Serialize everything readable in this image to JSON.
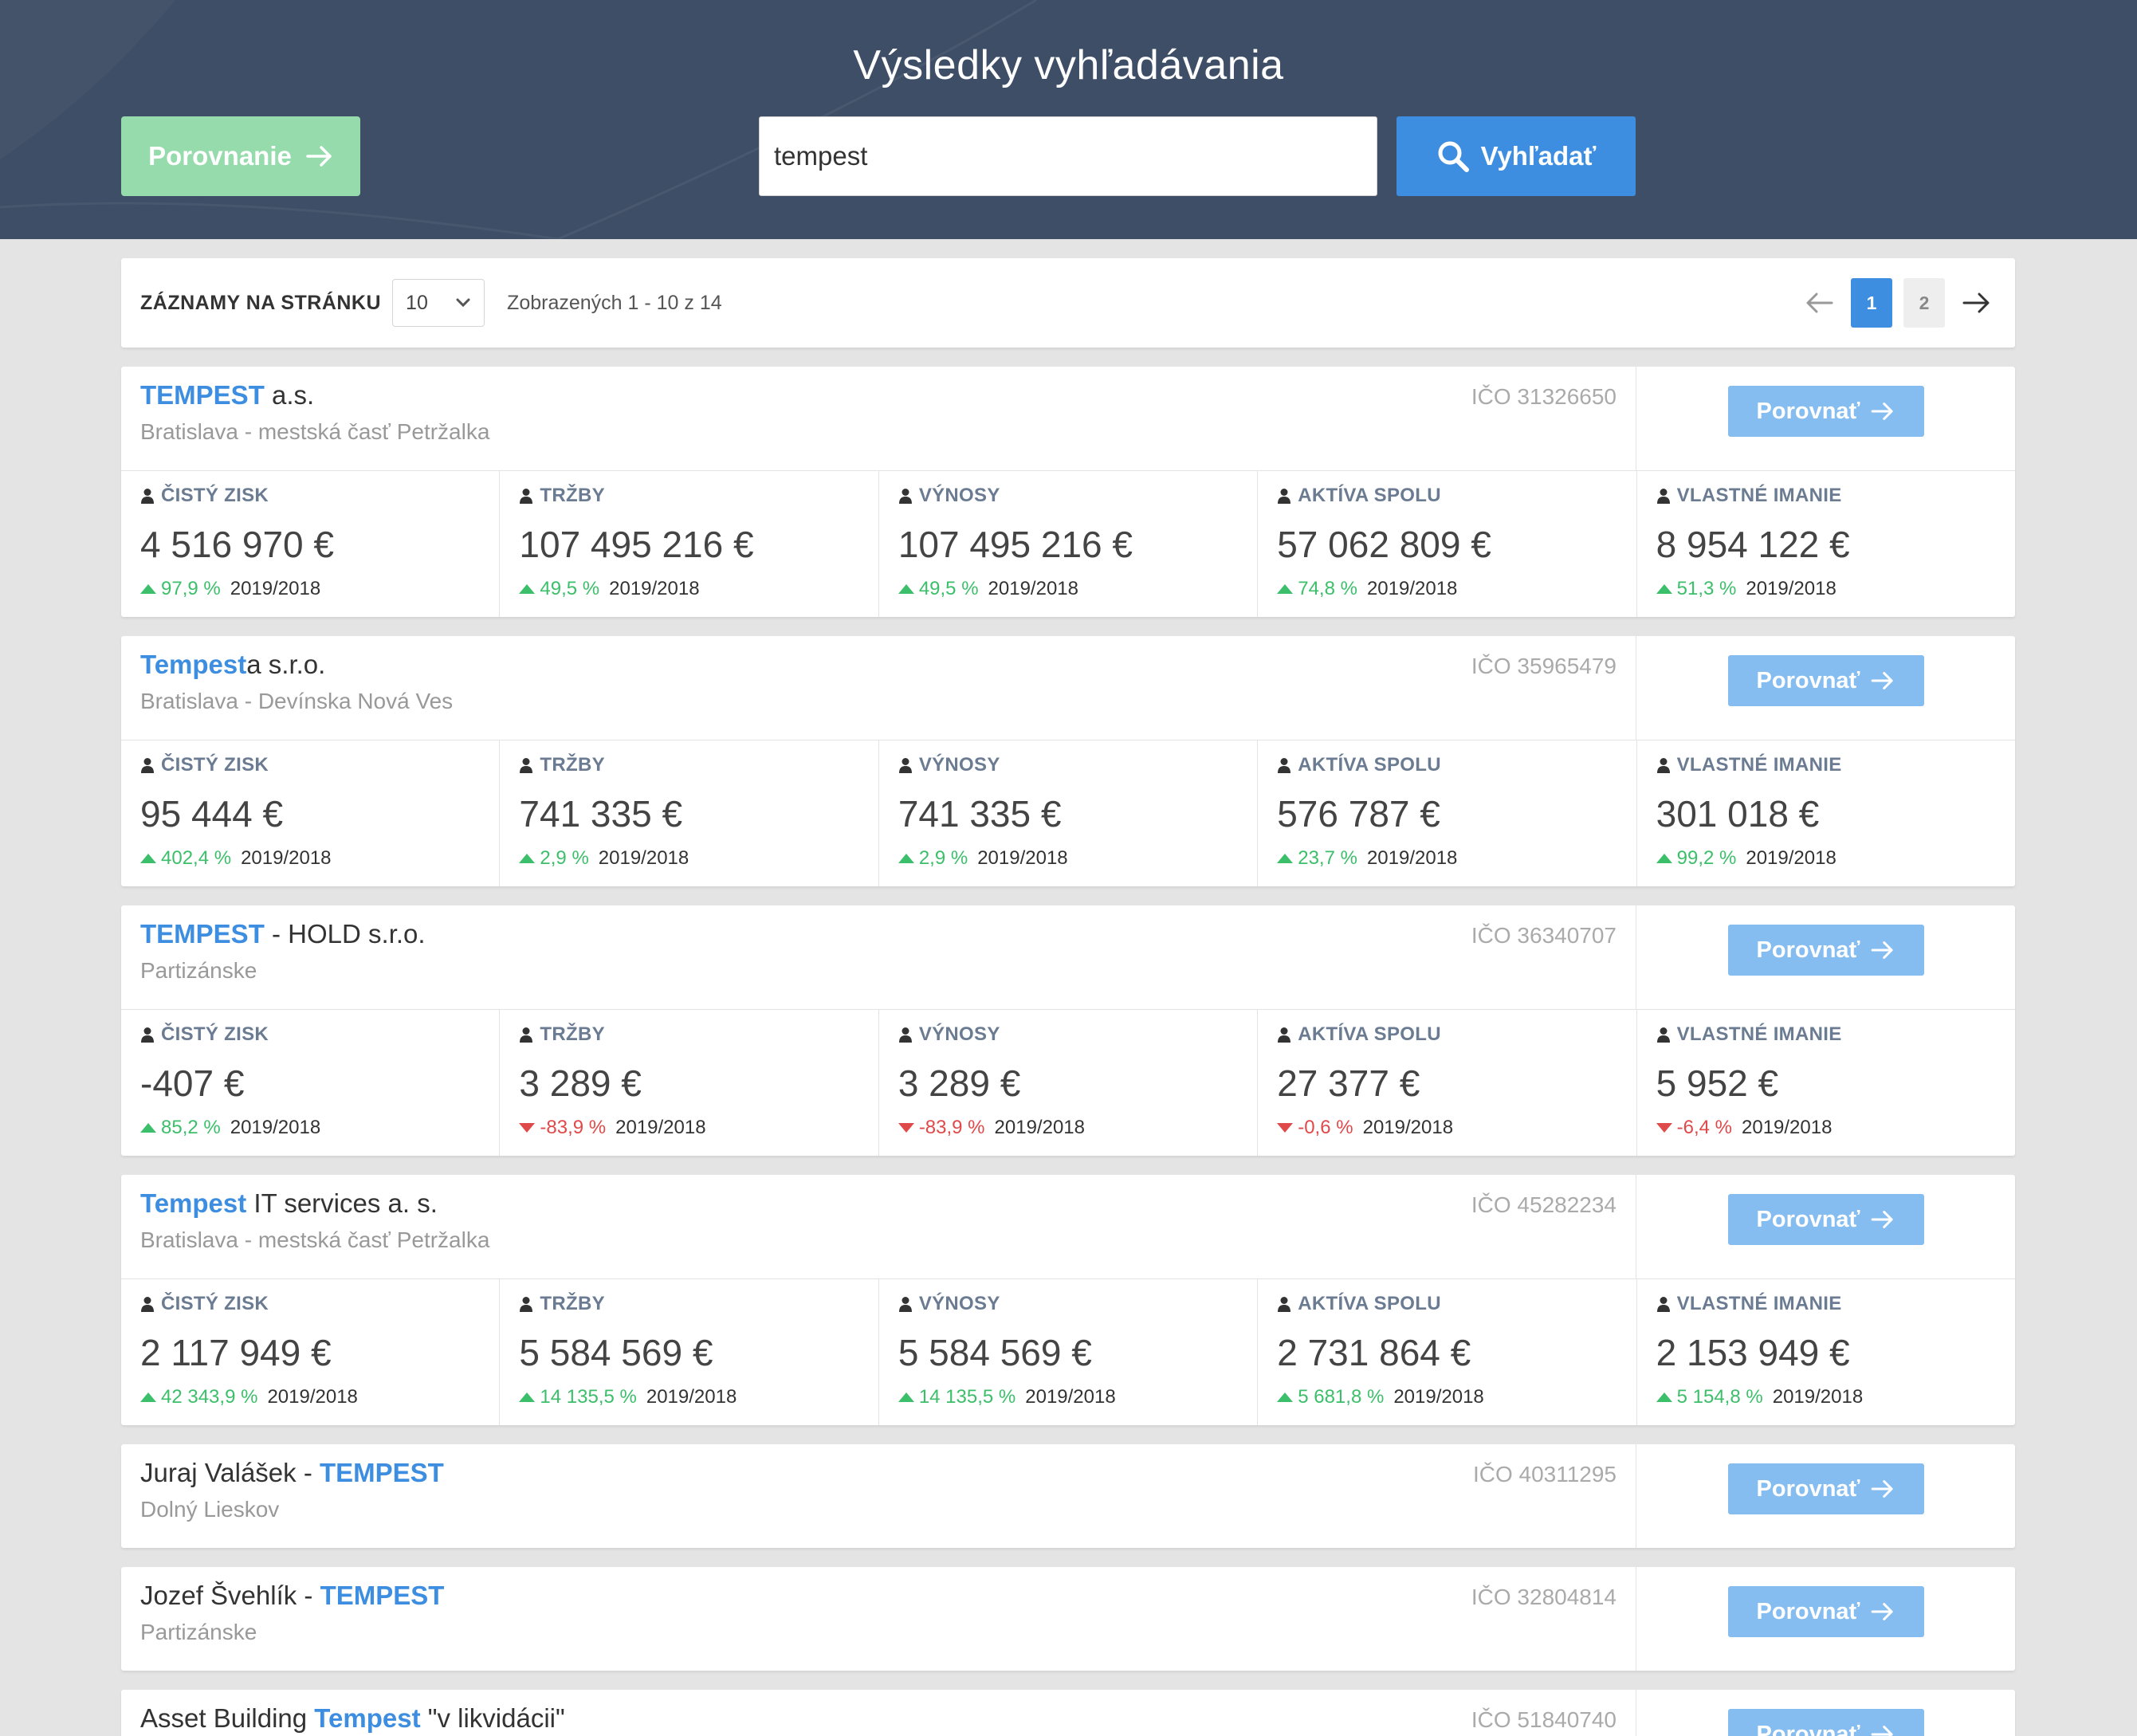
{
  "header": {
    "title": "Výsledky vyhľadávania",
    "compare_label": "Porovnanie",
    "search_value": "tempest",
    "search_label": "Vyhľadať"
  },
  "toolbar": {
    "per_page_label": "ZÁZNAMY NA STRÁNKU",
    "per_page_value": "10",
    "showing_text": "Zobrazených 1 - 10 z 14",
    "pages": [
      "1",
      "2"
    ],
    "current_page": "1"
  },
  "metric_labels": [
    "ČISTÝ ZISK",
    "TRŽBY",
    "VÝNOSY",
    "AKTÍVA SPOLU",
    "VLASTNÉ IMANIE"
  ],
  "compare_button_label": "Porovnať",
  "colors": {
    "header_bg": "#3e4e66",
    "primary": "#3d8ee0",
    "compare_green": "#96dbac",
    "up": "#3cbf6a",
    "down": "#e0494a"
  },
  "companies": [
    {
      "name_parts": [
        {
          "text": "TEMPEST",
          "hl": true
        },
        {
          "text": " a.s.",
          "hl": false
        }
      ],
      "city": "Bratislava - mestská časť Petržalka",
      "ico": "IČO 31326650",
      "metrics": [
        {
          "value": "4 516 970 €",
          "change": "97,9 %",
          "dir": "up",
          "period": "2019/2018"
        },
        {
          "value": "107 495 216 €",
          "change": "49,5 %",
          "dir": "up",
          "period": "2019/2018"
        },
        {
          "value": "107 495 216 €",
          "change": "49,5 %",
          "dir": "up",
          "period": "2019/2018"
        },
        {
          "value": "57 062 809 €",
          "change": "74,8 %",
          "dir": "up",
          "period": "2019/2018"
        },
        {
          "value": "8 954 122 €",
          "change": "51,3 %",
          "dir": "up",
          "period": "2019/2018"
        }
      ]
    },
    {
      "name_parts": [
        {
          "text": "Tempest",
          "hl": true
        },
        {
          "text": "a s.r.o.",
          "hl": false
        }
      ],
      "city": "Bratislava - Devínska Nová Ves",
      "ico": "IČO 35965479",
      "metrics": [
        {
          "value": "95 444 €",
          "change": "402,4 %",
          "dir": "up",
          "period": "2019/2018"
        },
        {
          "value": "741 335 €",
          "change": "2,9 %",
          "dir": "up",
          "period": "2019/2018"
        },
        {
          "value": "741 335 €",
          "change": "2,9 %",
          "dir": "up",
          "period": "2019/2018"
        },
        {
          "value": "576 787 €",
          "change": "23,7 %",
          "dir": "up",
          "period": "2019/2018"
        },
        {
          "value": "301 018 €",
          "change": "99,2 %",
          "dir": "up",
          "period": "2019/2018"
        }
      ]
    },
    {
      "name_parts": [
        {
          "text": "TEMPEST",
          "hl": true
        },
        {
          "text": " - HOLD s.r.o.",
          "hl": false
        }
      ],
      "city": "Partizánske",
      "ico": "IČO 36340707",
      "metrics": [
        {
          "value": "-407 €",
          "change": "85,2 %",
          "dir": "up",
          "period": "2019/2018"
        },
        {
          "value": "3 289 €",
          "change": "-83,9 %",
          "dir": "down",
          "period": "2019/2018"
        },
        {
          "value": "3 289 €",
          "change": "-83,9 %",
          "dir": "down",
          "period": "2019/2018"
        },
        {
          "value": "27 377 €",
          "change": "-0,6 %",
          "dir": "down",
          "period": "2019/2018"
        },
        {
          "value": "5 952 €",
          "change": "-6,4 %",
          "dir": "down",
          "period": "2019/2018"
        }
      ]
    },
    {
      "name_parts": [
        {
          "text": "Tempest",
          "hl": true
        },
        {
          "text": " IT services a. s.",
          "hl": false
        }
      ],
      "city": "Bratislava - mestská časť Petržalka",
      "ico": "IČO 45282234",
      "metrics": [
        {
          "value": "2 117 949 €",
          "change": "42 343,9 %",
          "dir": "up",
          "period": "2019/2018"
        },
        {
          "value": "5 584 569 €",
          "change": "14 135,5 %",
          "dir": "up",
          "period": "2019/2018"
        },
        {
          "value": "5 584 569 €",
          "change": "14 135,5 %",
          "dir": "up",
          "period": "2019/2018"
        },
        {
          "value": "2 731 864 €",
          "change": "5 681,8 %",
          "dir": "up",
          "period": "2019/2018"
        },
        {
          "value": "2 153 949 €",
          "change": "5 154,8 %",
          "dir": "up",
          "period": "2019/2018"
        }
      ]
    },
    {
      "name_parts": [
        {
          "text": "Juraj Valášek - ",
          "hl": false
        },
        {
          "text": "TEMPEST",
          "hl": true
        }
      ],
      "city": "Dolný Lieskov",
      "ico": "IČO 40311295",
      "metrics": []
    },
    {
      "name_parts": [
        {
          "text": "Jozef Švehlík - ",
          "hl": false
        },
        {
          "text": "TEMPEST",
          "hl": true
        }
      ],
      "city": "Partizánske",
      "ico": "IČO 32804814",
      "metrics": []
    },
    {
      "name_parts": [
        {
          "text": "Asset Building ",
          "hl": false
        },
        {
          "text": "Tempest",
          "hl": true
        },
        {
          "text": " \"v likvidácii\"",
          "hl": false
        }
      ],
      "city": "",
      "ico": "IČO 51840740",
      "metrics": []
    }
  ]
}
